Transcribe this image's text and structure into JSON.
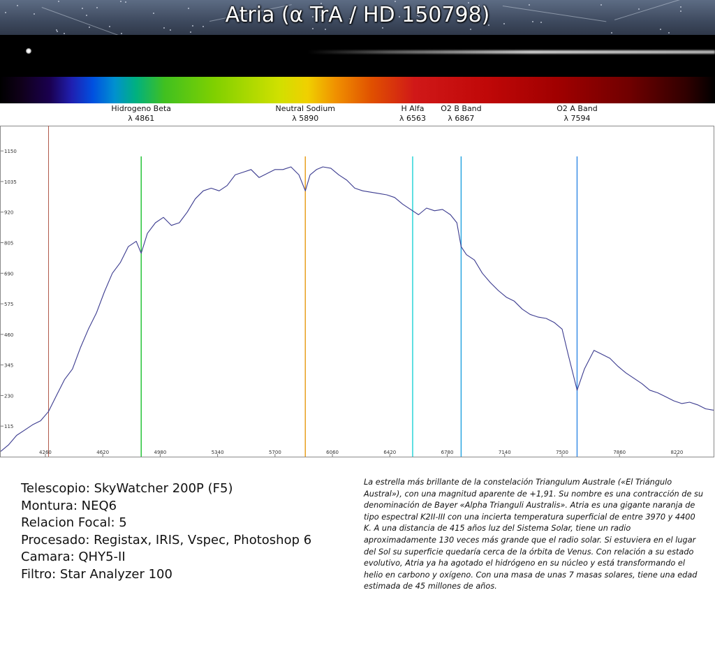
{
  "title": "Atria (α TrA / HD 150798)",
  "icons": {
    "star": "star-image-icon",
    "spectrum": "spectrum-strip-icon"
  },
  "colors": {
    "curve": "#3b3b8f",
    "frame": "#8a8a8a",
    "text": "#111111"
  },
  "chart_data": {
    "type": "line",
    "title": "",
    "xlabel": "",
    "ylabel": "",
    "xlim": [
      3980,
      8450
    ],
    "ylim": [
      0,
      1245
    ],
    "x_ticks": [
      4260,
      4620,
      4980,
      5340,
      5700,
      6060,
      6420,
      6780,
      7140,
      7500,
      7860,
      8220
    ],
    "y_ticks": [
      115,
      230,
      345,
      460,
      575,
      690,
      805,
      920,
      1035,
      1150
    ],
    "grid": false,
    "series": [
      {
        "x": [
          3980,
          4030,
          4080,
          4130,
          4180,
          4230,
          4280,
          4330,
          4380,
          4430,
          4480,
          4530,
          4580,
          4630,
          4680,
          4730,
          4780,
          4830,
          4861,
          4900,
          4950,
          5000,
          5050,
          5100,
          5150,
          5200,
          5250,
          5300,
          5350,
          5400,
          5450,
          5500,
          5550,
          5600,
          5650,
          5700,
          5750,
          5800,
          5850,
          5890,
          5920,
          5960,
          6000,
          6050,
          6100,
          6150,
          6200,
          6250,
          6300,
          6350,
          6400,
          6450,
          6500,
          6550,
          6600,
          6650,
          6700,
          6750,
          6800,
          6840,
          6867,
          6900,
          6950,
          7000,
          7050,
          7100,
          7150,
          7200,
          7250,
          7300,
          7350,
          7400,
          7450,
          7500,
          7540,
          7594,
          7640,
          7700,
          7750,
          7800,
          7850,
          7900,
          7950,
          8000,
          8050,
          8100,
          8150,
          8200,
          8250,
          8300,
          8350,
          8400,
          8450
        ],
        "y": [
          20,
          45,
          80,
          100,
          120,
          135,
          170,
          230,
          290,
          330,
          410,
          480,
          540,
          620,
          690,
          730,
          790,
          810,
          765,
          840,
          880,
          900,
          870,
          880,
          920,
          970,
          1000,
          1010,
          1000,
          1020,
          1060,
          1070,
          1080,
          1050,
          1065,
          1080,
          1080,
          1090,
          1060,
          1000,
          1060,
          1080,
          1090,
          1085,
          1060,
          1040,
          1010,
          1000,
          995,
          990,
          985,
          975,
          950,
          930,
          910,
          935,
          925,
          930,
          910,
          880,
          790,
          760,
          740,
          690,
          655,
          625,
          600,
          585,
          555,
          535,
          525,
          520,
          505,
          480,
          380,
          250,
          330,
          400,
          385,
          370,
          340,
          315,
          295,
          275,
          250,
          240,
          225,
          210,
          200,
          205,
          195,
          180,
          175
        ]
      }
    ],
    "markers": [
      {
        "name": "Hidrogeno Beta",
        "label": "λ 4861",
        "x": 4861,
        "color": "#27c43a"
      },
      {
        "name": "Neutral Sodium",
        "label": "λ 5890",
        "x": 5890,
        "color": "#e8a020"
      },
      {
        "name": "H Alfa",
        "label": "λ 6563",
        "x": 6563,
        "color": "#2ad4d8"
      },
      {
        "name": "O2 B Band",
        "label": "λ 6867",
        "x": 6867,
        "color": "#2aa6e0"
      },
      {
        "name": "O2 A Band",
        "label": "λ 7594",
        "x": 7594,
        "color": "#3a8ee6"
      }
    ],
    "reference_line": {
      "x": 4280,
      "color": "#b0584a"
    }
  },
  "specs": [
    "Telescopio: SkyWatcher 200P (F5)",
    "Montura: NEQ6",
    "Relacion Focal: 5",
    "Procesado: Registax, IRIS, Vspec, Photoshop 6",
    "Camara: QHY5-II",
    "Filtro: Star Analyzer 100"
  ],
  "description": "La estrella más brillante de la constelación Triangulum Australe («El Triángulo Austral»), con una magnitud aparente de +1,91. Su nombre es una contracción de su denominación de Bayer «Alpha Trianguli Australis». Atria es una gigante naranja de tipo espectral K2II-III con una incierta temperatura superficial de entre 3970 y 4400 K. A una distancia de 415 años luz del Sistema Solar, tiene un radio aproximadamente 130 veces más grande que el radio solar. Si estuviera en el lugar del Sol su superficie quedaría cerca de la órbita de Venus. Con relación a su estado evolutivo, Atria ya ha agotado el hidrógeno en su núcleo y está transformando el helio en carbono y oxígeno. Con una masa de unas 7 masas solares, tiene una edad estimada de 45 millones de años."
}
